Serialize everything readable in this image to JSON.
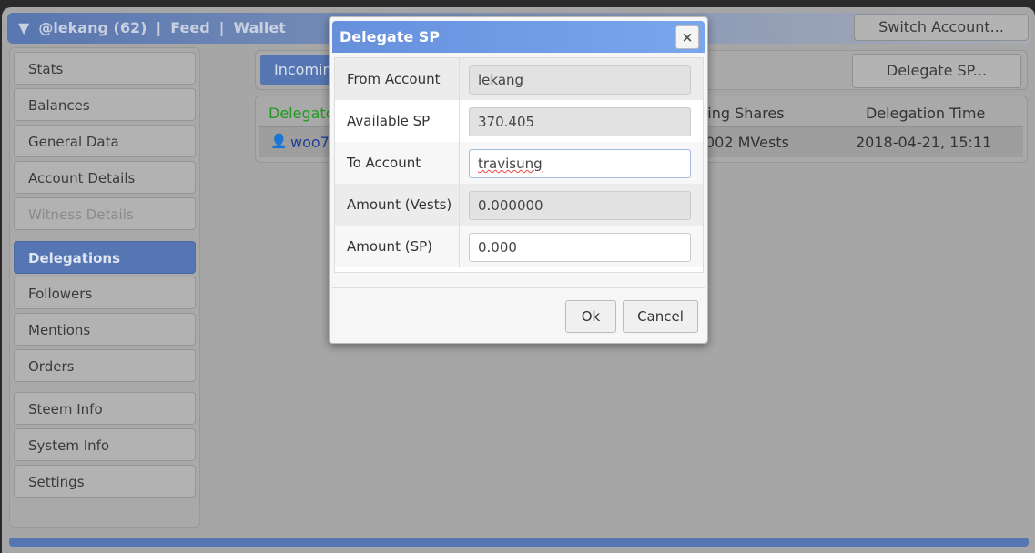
{
  "header": {
    "account": "@lekang (62)",
    "sep": "|",
    "feed": "Feed",
    "wallet": "Wallet",
    "switch_account": "Switch Account..."
  },
  "sidebar": {
    "items": [
      {
        "label": "Stats"
      },
      {
        "label": "Balances"
      },
      {
        "label": "General Data"
      },
      {
        "label": "Account Details"
      },
      {
        "label": "Witness Details",
        "disabled": true
      },
      {
        "label": "Delegations",
        "active": true
      },
      {
        "label": "Followers"
      },
      {
        "label": "Mentions"
      },
      {
        "label": "Orders"
      },
      {
        "label": "Steem Info"
      },
      {
        "label": "System Info"
      },
      {
        "label": "Settings"
      }
    ]
  },
  "main": {
    "tab_incoming": "Incoming",
    "delegate_button": "Delegate SP...",
    "table": {
      "columns": [
        "Delegator",
        "Vesting Shares",
        "Delegation Time"
      ],
      "visible_columns": [
        "Delegato",
        "ting Shares",
        "Delegation Time"
      ],
      "rows": [
        {
          "delegator": "woo7",
          "vesting": "002 MVests",
          "time": "2018-04-21, 15:11"
        }
      ]
    }
  },
  "dialog": {
    "title": "Delegate SP",
    "close": "×",
    "fields": [
      {
        "label": "From Account",
        "value": "lekang"
      },
      {
        "label": "Available SP",
        "value": "370.405"
      },
      {
        "label": "To Account",
        "value": "travisung"
      },
      {
        "label": "Amount (Vests)",
        "value": "0.000000"
      },
      {
        "label": "Amount (SP)",
        "value": "0.000"
      }
    ],
    "ok": "Ok",
    "cancel": "Cancel"
  },
  "colors": {
    "accent": "#5576b3",
    "dialog_title": "#6d9be6",
    "delegator_header": "#1f9a1f",
    "link": "#1d3f9a"
  }
}
